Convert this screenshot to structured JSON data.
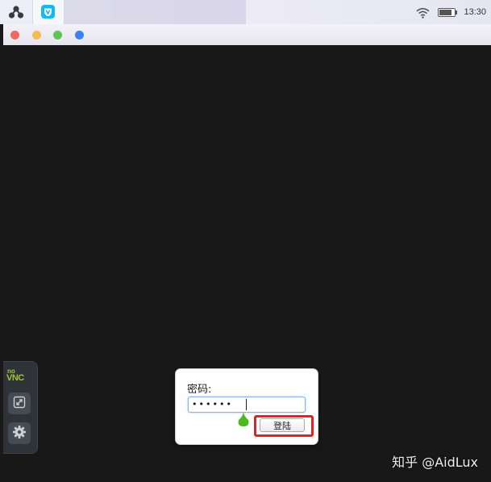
{
  "system_bar": {
    "clock": "13:30",
    "icons": [
      "launcher-icon",
      "app-tab-icon",
      "wifi-icon",
      "battery-icon"
    ],
    "battery_level": 0.8,
    "app_tab_color": "#17b7f0"
  },
  "window": {
    "traffic_lights": [
      "#ee6a5f",
      "#f5bd4f",
      "#61c454",
      "#3b82f6"
    ]
  },
  "novnc_panel": {
    "logo_no": "no",
    "logo_vnc": "VNC",
    "buttons": [
      "fullscreen-icon",
      "gear-icon"
    ]
  },
  "login_dialog": {
    "label": "密码:",
    "password_value": "••••••",
    "submit_label": "登陆",
    "highlight_color": "#e02424"
  },
  "watermark": "知乎 @AidLux"
}
